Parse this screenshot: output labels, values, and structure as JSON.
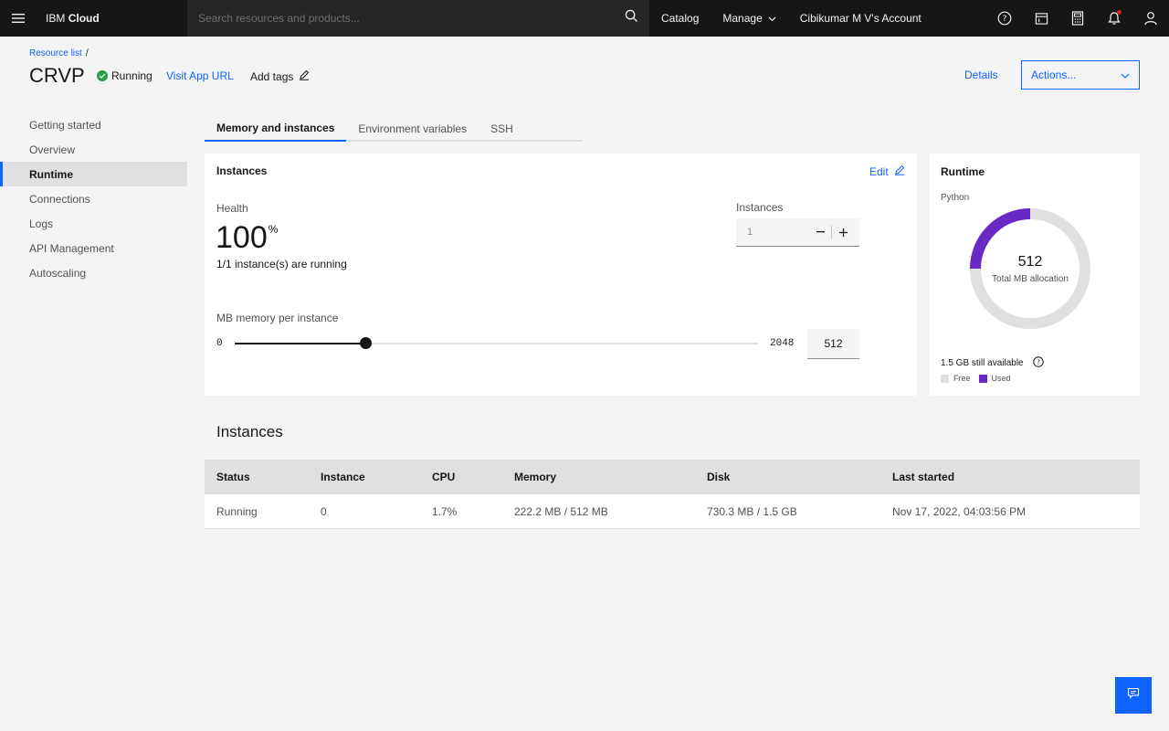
{
  "header": {
    "brand_prefix": "IBM",
    "brand_name": "Cloud",
    "search_placeholder": "Search resources and products...",
    "catalog": "Catalog",
    "manage": "Manage",
    "account": "Cibikumar M V's Account"
  },
  "breadcrumb": {
    "link": "Resource list",
    "separator": "/"
  },
  "app": {
    "title": "CRVP",
    "status": "Running",
    "visit_url": "Visit App URL",
    "add_tags": "Add tags",
    "details": "Details",
    "actions": "Actions..."
  },
  "sidebar": {
    "items": [
      {
        "label": "Getting started"
      },
      {
        "label": "Overview"
      },
      {
        "label": "Runtime"
      },
      {
        "label": "Connections"
      },
      {
        "label": "Logs"
      },
      {
        "label": "API Management"
      },
      {
        "label": "Autoscaling"
      }
    ]
  },
  "tabs": [
    {
      "label": "Memory and instances"
    },
    {
      "label": "Environment variables"
    },
    {
      "label": "SSH"
    }
  ],
  "instances_card": {
    "title": "Instances",
    "edit": "Edit",
    "health_label": "Health",
    "health_value": "100",
    "health_unit": "%",
    "running_text": "1/1 instance(s) are running",
    "instances_label": "Instances",
    "instances_value": "1",
    "memory_label": "MB memory per instance",
    "slider_min": "0",
    "slider_max": "2048",
    "memory_value": "512",
    "memory_fraction": 0.25
  },
  "runtime_card": {
    "title": "Runtime",
    "language": "Python",
    "total_value": "512",
    "total_label": "Total MB allocation",
    "available": "1.5 GB still available",
    "legend_free": "Free",
    "legend_used": "Used",
    "used_fraction": 0.25,
    "color_used": "#6929c4",
    "color_free": "#e0e0e0"
  },
  "instances_table": {
    "title": "Instances",
    "columns": [
      "Status",
      "Instance",
      "CPU",
      "Memory",
      "Disk",
      "Last started"
    ],
    "rows": [
      [
        "Running",
        "0",
        "1.7%",
        "222.2 MB / 512 MB",
        "730.3 MB / 1.5 GB",
        "Nov 17, 2022, 04:03:56 PM"
      ]
    ]
  },
  "colors": {
    "accent": "#0f62fe",
    "header_bg": "#161616",
    "success": "#24a148"
  }
}
